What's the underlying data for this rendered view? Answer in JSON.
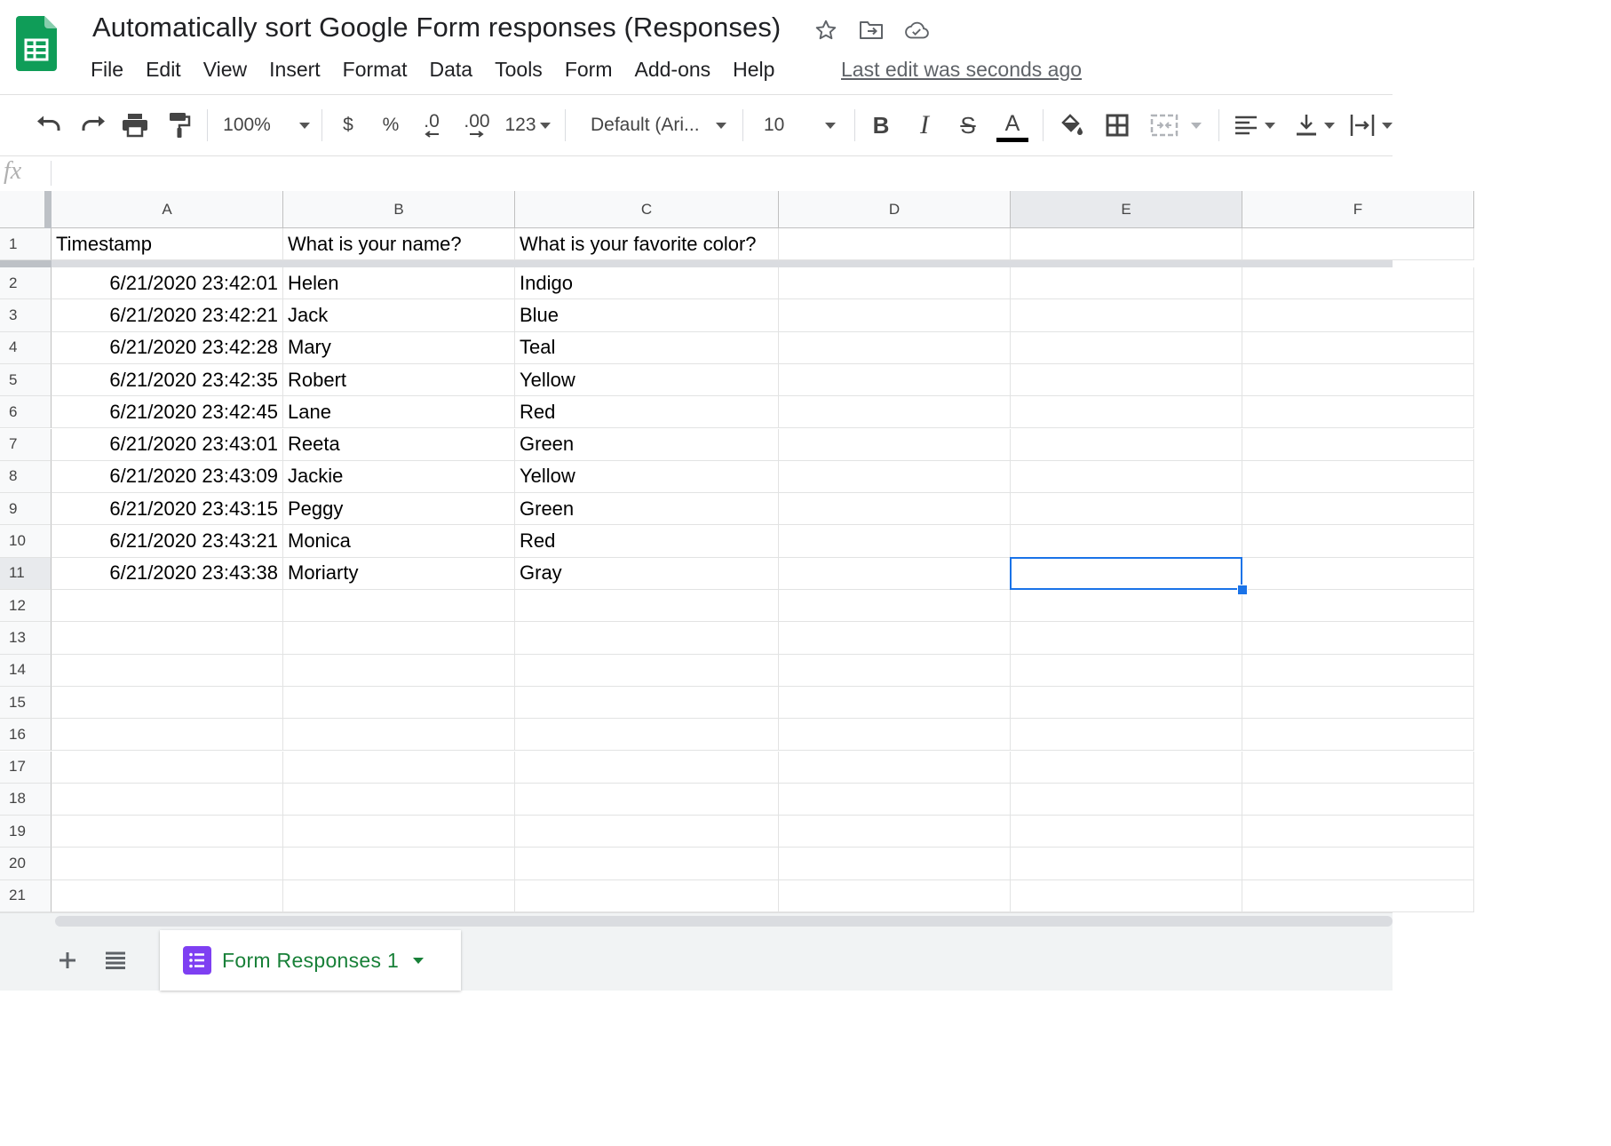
{
  "app": {
    "title": "Automatically sort Google Form responses (Responses)",
    "last_edit": "Last edit was seconds ago",
    "brand_color": "#0f9d58"
  },
  "menu": [
    "File",
    "Edit",
    "View",
    "Insert",
    "Format",
    "Data",
    "Tools",
    "Form",
    "Add-ons",
    "Help"
  ],
  "toolbar": {
    "zoom": "100%",
    "currency": "$",
    "percent": "%",
    "decrease_decimal": ".0",
    "increase_decimal": ".00",
    "more_formats": "123",
    "font": "Default (Ari...",
    "font_size": "10",
    "bold": "B",
    "italic": "I",
    "strikethrough": "S",
    "text_color_letter": "A"
  },
  "formula_bar": {
    "label": "fx",
    "value": ""
  },
  "grid": {
    "columns": [
      "A",
      "B",
      "C",
      "D",
      "E",
      "F"
    ],
    "row_numbers": [
      "1",
      "2",
      "3",
      "4",
      "5",
      "6",
      "7",
      "8",
      "9",
      "10",
      "11",
      "12",
      "13",
      "14",
      "15",
      "16",
      "17",
      "18",
      "19",
      "20",
      "21"
    ],
    "header_row": [
      "Timestamp",
      "What is your name?",
      "What is your favorite color?"
    ],
    "rows": [
      [
        "6/21/2020 23:42:01",
        "Helen",
        "Indigo"
      ],
      [
        "6/21/2020 23:42:21",
        "Jack",
        "Blue"
      ],
      [
        "6/21/2020 23:42:28",
        "Mary",
        "Teal"
      ],
      [
        "6/21/2020 23:42:35",
        "Robert",
        "Yellow"
      ],
      [
        "6/21/2020 23:42:45",
        "Lane",
        "Red"
      ],
      [
        "6/21/2020 23:43:01",
        "Reeta",
        "Green"
      ],
      [
        "6/21/2020 23:43:09",
        "Jackie",
        "Yellow"
      ],
      [
        "6/21/2020 23:43:15",
        "Peggy",
        "Green"
      ],
      [
        "6/21/2020 23:43:21",
        "Monica",
        "Red"
      ],
      [
        "6/21/2020 23:43:38",
        "Moriarty",
        "Gray"
      ]
    ],
    "selected_cell": "E11",
    "selection_color": "#1a73e8"
  },
  "sheets": {
    "active": "Form Responses 1",
    "tab_color": "#188038",
    "form_icon_color": "#7e3ff2"
  }
}
